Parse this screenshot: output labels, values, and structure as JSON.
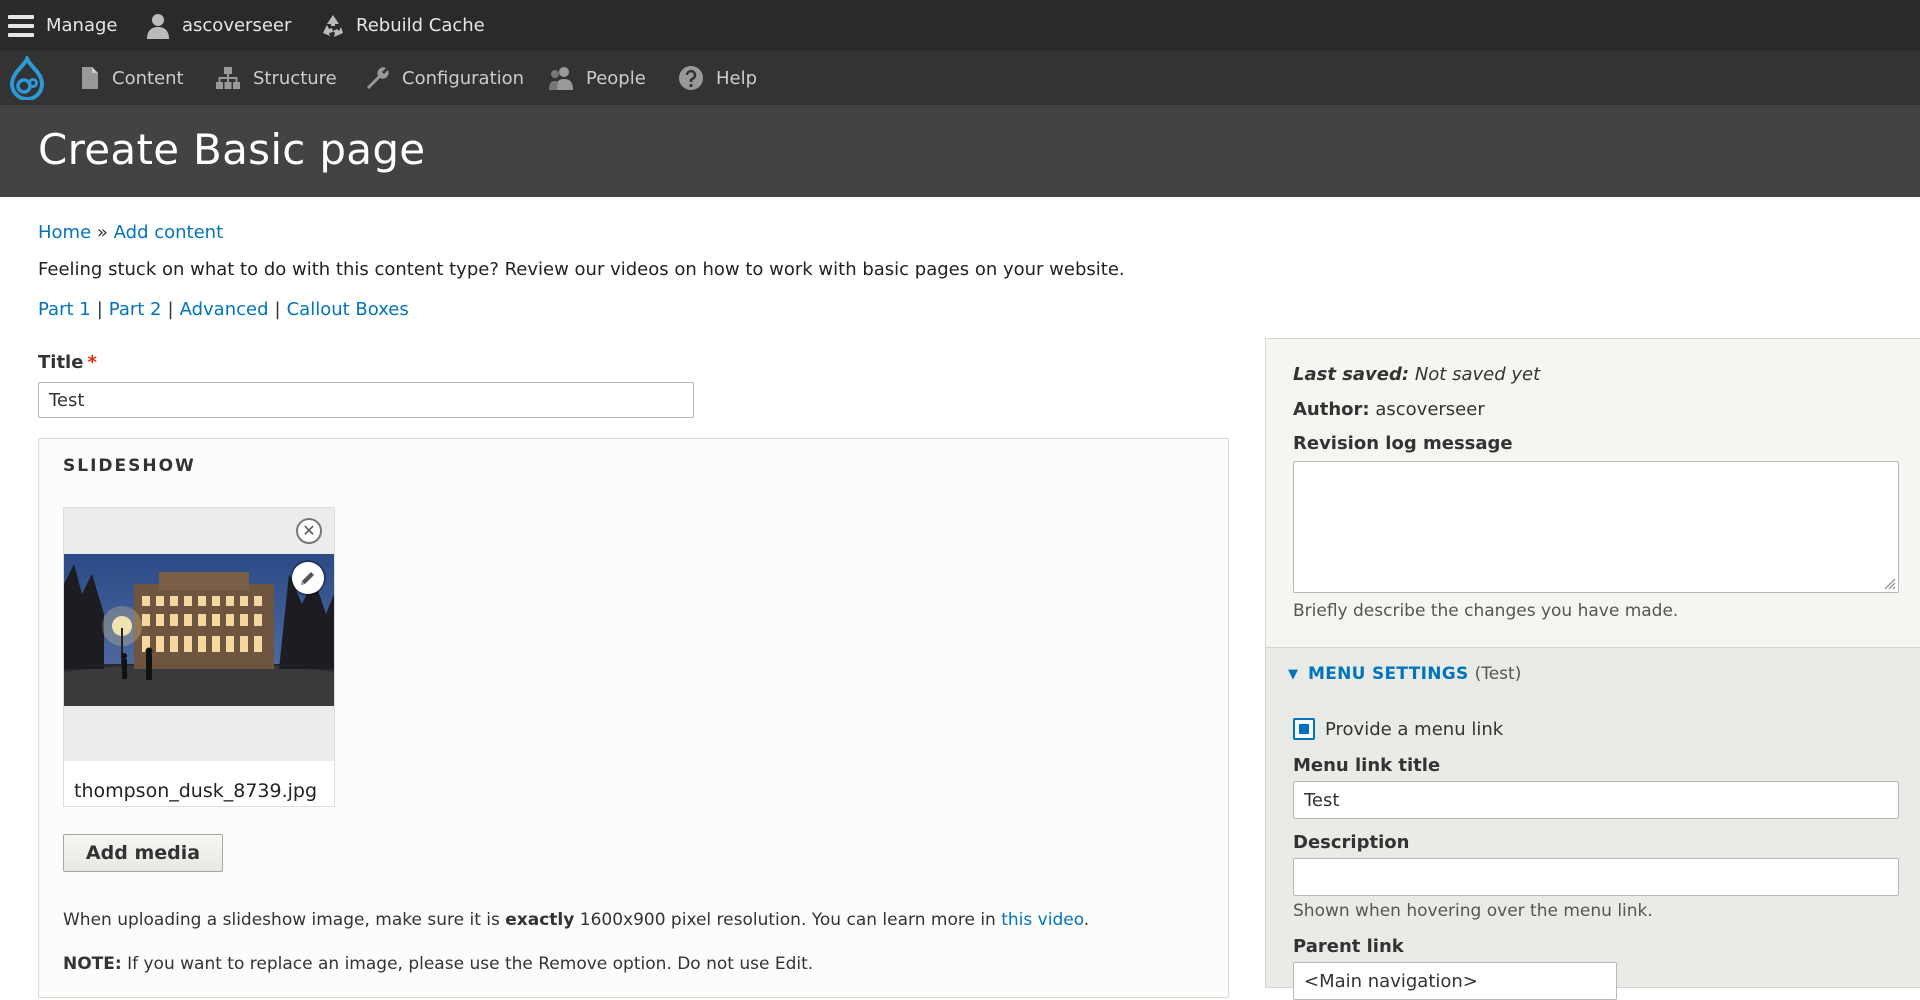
{
  "toolbar": {
    "manage_label": "Manage",
    "user_label": "ascoverseer",
    "rebuild_label": "Rebuild Cache"
  },
  "tray": {
    "items": [
      {
        "label": "Content",
        "icon": "file-icon"
      },
      {
        "label": "Structure",
        "icon": "sitemap-icon"
      },
      {
        "label": "Configuration",
        "icon": "wrench-icon"
      },
      {
        "label": "People",
        "icon": "people-icon"
      },
      {
        "label": "Help",
        "icon": "help-icon"
      }
    ]
  },
  "page": {
    "title": "Create Basic page",
    "breadcrumb": {
      "home": "Home",
      "sep": "»",
      "add_content": "Add content"
    },
    "intro": "Feeling stuck on what to do with this content type? Review our videos on how to work with basic pages on your website.",
    "video_links": [
      "Part 1",
      "Part 2",
      "Advanced",
      "Callout Boxes"
    ],
    "video_sep": "|"
  },
  "form": {
    "title_label": "Title",
    "required_mark": "*",
    "title_value": "Test",
    "slideshow": {
      "legend": "SLIDESHOW",
      "remove_symbol": "✕",
      "filename": "thompson_dusk_8739.jpg",
      "add_media_label": "Add media",
      "help1_pre": "When uploading a slideshow image, make sure it is ",
      "help1_bold": "exactly",
      "help1_mid": " 1600x900 pixel resolution. You can learn more in ",
      "help1_link": "this video",
      "help1_end": ".",
      "help2_bold": "NOTE:",
      "help2_text": " If you want to replace an image, please use the Remove option. Do not use Edit."
    }
  },
  "sidebar": {
    "last_saved_label": "Last saved:",
    "last_saved_value": "Not saved yet",
    "author_label": "Author:",
    "author_value": "ascoverseer",
    "revision_label": "Revision log message",
    "revision_value": "",
    "revision_help": "Briefly describe the changes you have made.",
    "menu": {
      "title": "MENU SETTINGS",
      "summary": "(Test)",
      "provide_link_label": "Provide a menu link",
      "provide_link_checked": true,
      "link_title_label": "Menu link title",
      "link_title_value": "Test",
      "description_label": "Description",
      "description_value": "",
      "description_help": "Shown when hovering over the menu link.",
      "parent_label": "Parent link",
      "parent_value": "<Main navigation>"
    }
  },
  "colors": {
    "toolbar_bg": "#2a2a2a",
    "tray_bg": "#333333",
    "header_bg": "#434343",
    "link": "#0074bd",
    "required": "#e32700"
  }
}
